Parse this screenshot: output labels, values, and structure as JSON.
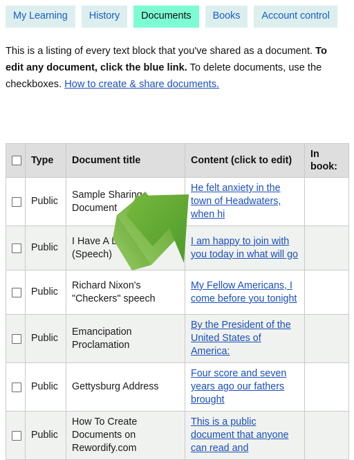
{
  "tabs": [
    {
      "label": "My Learning",
      "active": false
    },
    {
      "label": "History",
      "active": false
    },
    {
      "label": "Documents",
      "active": true
    },
    {
      "label": "Books",
      "active": false
    },
    {
      "label": "Account control",
      "active": false
    }
  ],
  "intro": {
    "part1": "This is a listing of every text block that you've shared as a document. ",
    "bold": "To edit any document, click the blue link.",
    "part2": " To delete documents, use the checkboxes. ",
    "link": "How to create & share documents."
  },
  "table": {
    "headers": {
      "checkbox": "",
      "type": "Type",
      "title": "Document title",
      "content": "Content (click to edit)",
      "inbook": "In book:"
    },
    "rows": [
      {
        "type": "Public",
        "title": "Sample Sharing Document",
        "content": "He felt anxiety in the town of Headwaters, when hi",
        "inbook": ""
      },
      {
        "type": "Public",
        "title": "I Have A Dream (Speech)",
        "content": "I am happy to join with you today in what will go",
        "inbook": ""
      },
      {
        "type": "Public",
        "title": "Richard Nixon's \"Checkers\" speech",
        "content": "My Fellow Americans, I come before you tonight",
        "inbook": ""
      },
      {
        "type": "Public",
        "title": "Emancipation Proclamation",
        "content": "By the President of the United States of America:",
        "inbook": ""
      },
      {
        "type": "Public",
        "title": "Gettysburg Address",
        "content": "Four score and seven years ago our fathers brought",
        "inbook": ""
      },
      {
        "type": "Public",
        "title": "How To Create Documents on Rewordify.com",
        "content": "This is a public document that anyone can read and",
        "inbook": ""
      }
    ]
  },
  "colors": {
    "tab_inactive_bg": "#dcefee",
    "tab_active_bg": "#7dfcd3",
    "link": "#1a4fbb",
    "header_bg": "#dedede",
    "row_alt_bg": "#f0f2f0",
    "arrow_green_light": "#8cc44e",
    "arrow_green_dark": "#4e9c2e"
  },
  "overlay": {
    "arrow_icon": "arrow-up-right-pointer"
  }
}
